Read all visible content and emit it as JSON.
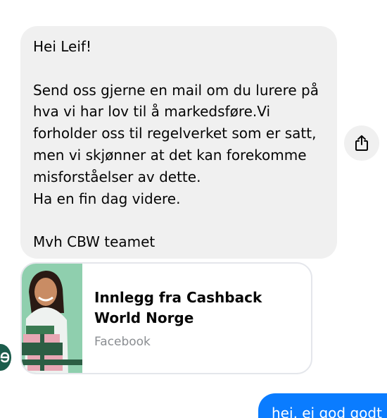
{
  "incoming_message": {
    "text": "Hei Leif!\n\nSend oss gjerne en mail om du lurere på hva vi har lov til å markedsføre.Vi forholder oss til regelverket som er satt, men vi skjønner at det kan forekomme misforståelser av dette.\nHa en fin dag videre.\n\nMvh CBW teamet"
  },
  "share_button": {
    "icon": "share-icon"
  },
  "link_card": {
    "title": "Innlegg fra Cashback World Norge",
    "source": "Facebook",
    "thumbnail_icon": "woman-with-gift-boxes-image"
  },
  "sender_avatar": {
    "icon": "cashback-world-logo"
  },
  "outgoing_message": {
    "text": "hei, ei god godt"
  },
  "colors": {
    "incoming_bubble": "#f0f0f0",
    "outgoing_bubble": "#0a7cff",
    "avatar": "#1b5c4b",
    "card_border": "#e4e6eb",
    "secondary_text": "#8a8d91"
  }
}
